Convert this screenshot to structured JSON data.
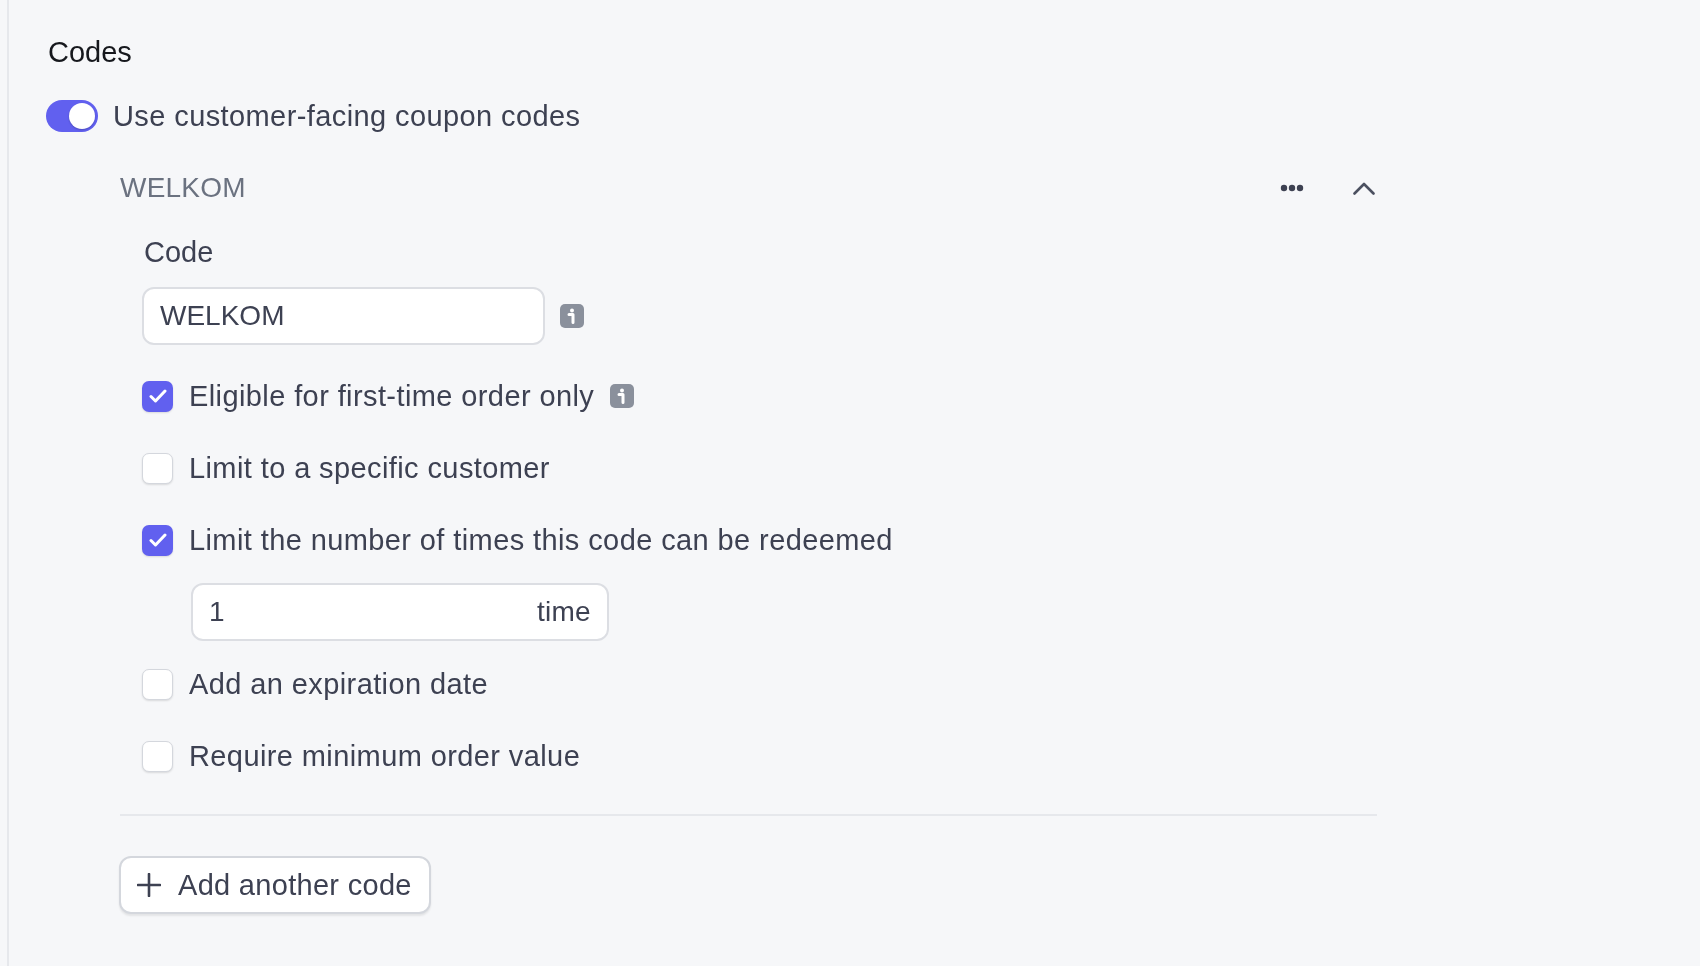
{
  "section": {
    "title": "Codes"
  },
  "coupon_toggle": {
    "label": "Use customer-facing coupon codes",
    "on": true
  },
  "code_card": {
    "title": "WELKOM",
    "expanded": true,
    "code_field": {
      "label": "Code",
      "value": "WELKOM",
      "info": true
    },
    "options": [
      {
        "label": "Eligible for first-time order only",
        "checked": true,
        "info": true
      },
      {
        "label": "Limit to a specific customer",
        "checked": false,
        "info": false
      },
      {
        "label": "Limit the number of times this code can be redeemed",
        "checked": true,
        "info": false,
        "count_field": {
          "value": "1",
          "unit": "time"
        }
      },
      {
        "label": "Add an expiration date",
        "checked": false,
        "info": false
      },
      {
        "label": "Require minimum order value",
        "checked": false,
        "info": false
      }
    ]
  },
  "add_button": {
    "label": "Add another code"
  }
}
